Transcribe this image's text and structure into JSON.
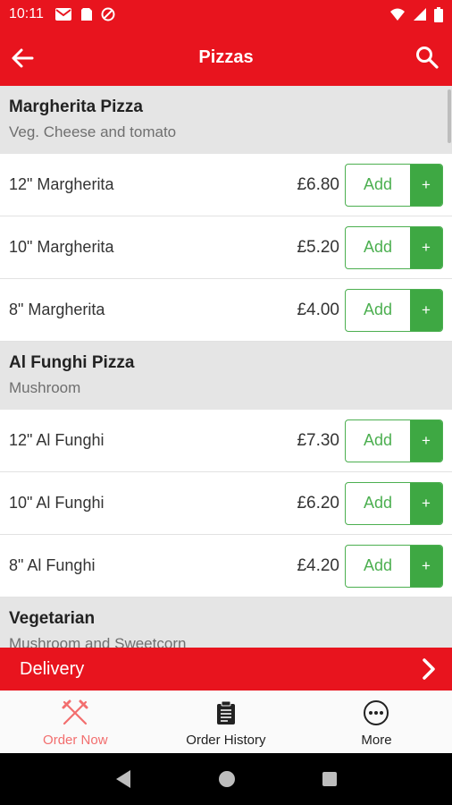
{
  "status_bar": {
    "time": "10:11"
  },
  "header": {
    "title": "Pizzas"
  },
  "sections": [
    {
      "name": "Margherita Pizza",
      "description": "Veg. Cheese and tomato",
      "items": [
        {
          "name": "12\" Margherita",
          "price": "£6.80"
        },
        {
          "name": "10\" Margherita",
          "price": "£5.20"
        },
        {
          "name": "8\" Margherita",
          "price": "£4.00"
        }
      ]
    },
    {
      "name": "Al Funghi Pizza",
      "description": "Mushroom",
      "items": [
        {
          "name": "12\" Al Funghi",
          "price": "£7.30"
        },
        {
          "name": "10\" Al Funghi",
          "price": "£6.20"
        },
        {
          "name": "8\" Al Funghi",
          "price": "£4.20"
        }
      ]
    },
    {
      "name": "Vegetarian",
      "description": "Mushroom and Sweetcorn",
      "items": []
    }
  ],
  "add_button": {
    "label": "Add",
    "plus": "+"
  },
  "delivery_bar": {
    "label": "Delivery"
  },
  "bottom_nav": {
    "items": [
      {
        "label": "Order Now",
        "icon": "fork-knife-icon",
        "active": true
      },
      {
        "label": "Order History",
        "icon": "clipboard-icon",
        "active": false
      },
      {
        "label": "More",
        "icon": "more-circle-icon",
        "active": false
      }
    ]
  },
  "colors": {
    "brand_red": "#e8141e",
    "add_green": "#4caf50",
    "active_nav": "#f26e6e"
  }
}
